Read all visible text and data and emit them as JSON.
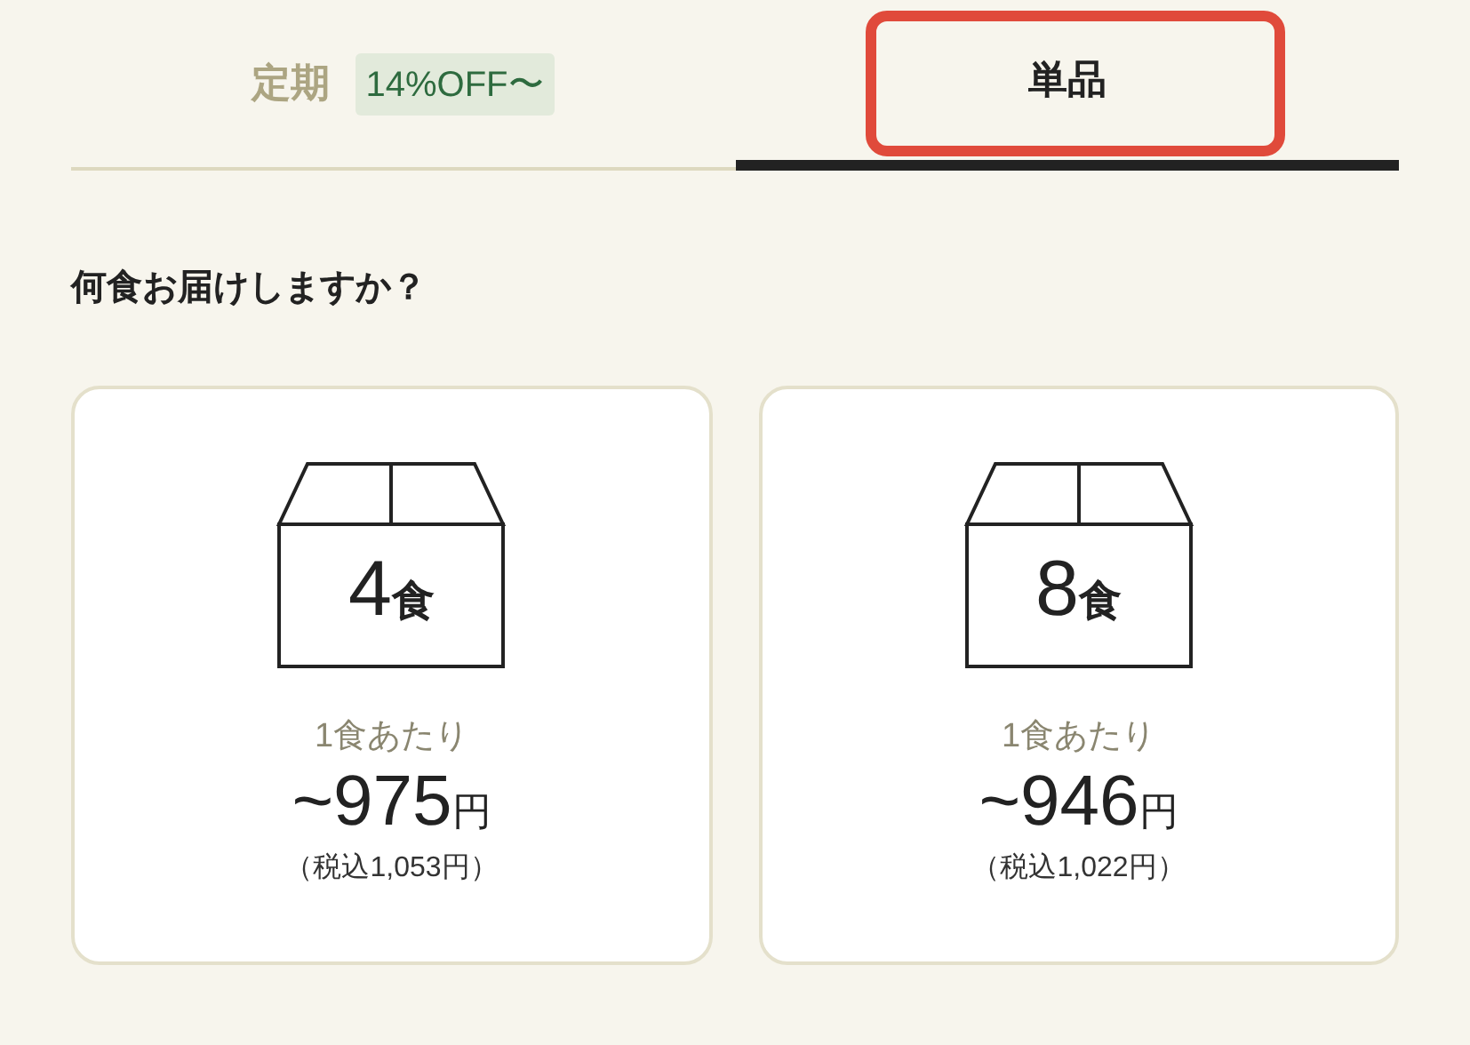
{
  "tabs": [
    {
      "label": "定期",
      "badge": "14%OFF〜",
      "selected": false,
      "highlighted": false
    },
    {
      "label": "単品",
      "selected": true,
      "highlighted": true
    }
  ],
  "heading": "何食お届けしますか？",
  "plans": [
    {
      "count": "4",
      "count_unit": "食",
      "per_label": "1食あたり",
      "price": "~975",
      "price_unit": "円",
      "tax_note": "（税込1,053円）",
      "selected": false
    },
    {
      "count": "8",
      "count_unit": "食",
      "per_label": "1食あたり",
      "price": "~946",
      "price_unit": "円",
      "tax_note": "（税込1,022円）",
      "selected": false
    }
  ]
}
